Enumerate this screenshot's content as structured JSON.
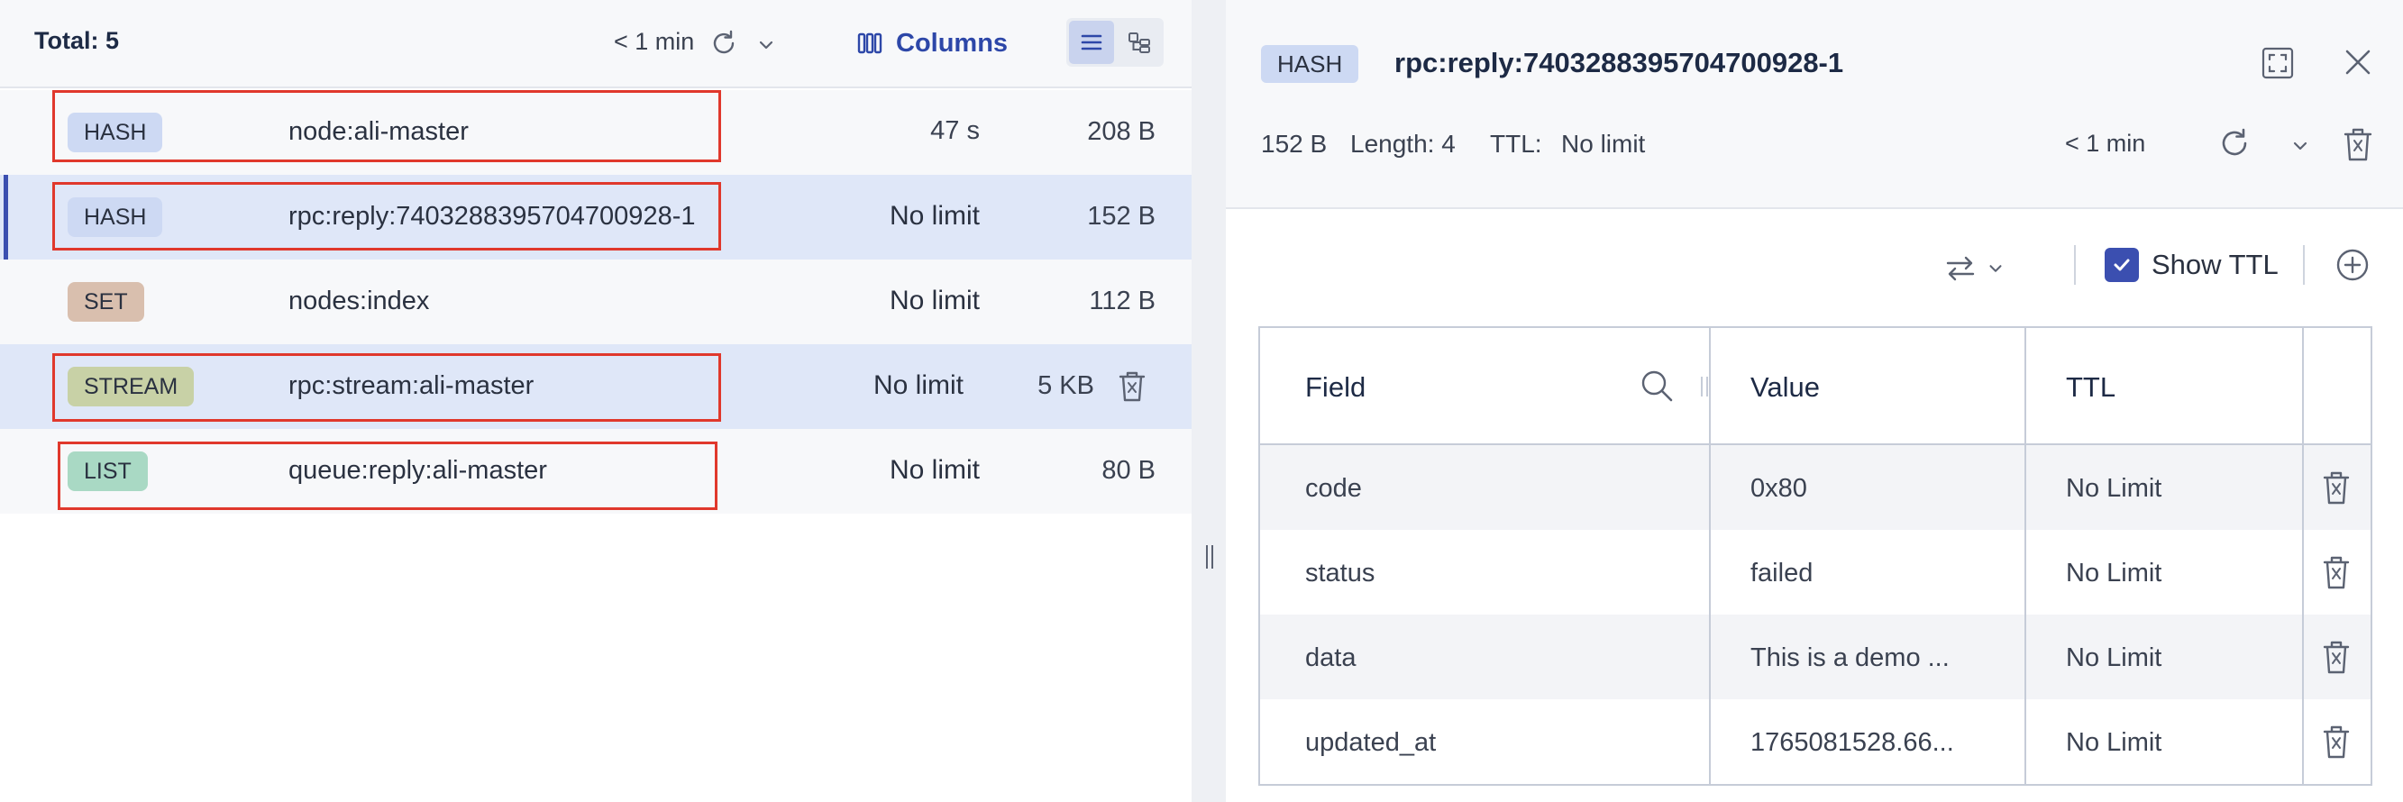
{
  "key_list": {
    "total_label": "Total: 5",
    "refresh_text": "< 1 min",
    "columns_label": "Columns",
    "rows": [
      {
        "type": "HASH",
        "name": "node:ali-master",
        "ttl": "47 s",
        "size": "208 B"
      },
      {
        "type": "HASH",
        "name": "rpc:reply:7403288395704700928-1",
        "ttl": "No limit",
        "size": "152 B"
      },
      {
        "type": "SET",
        "name": "nodes:index",
        "ttl": "No limit",
        "size": "112 B"
      },
      {
        "type": "STREAM",
        "name": "rpc:stream:ali-master",
        "ttl": "No limit",
        "size": "5 KB"
      },
      {
        "type": "LIST",
        "name": "queue:reply:ali-master",
        "ttl": "No limit",
        "size": "80 B"
      }
    ]
  },
  "details": {
    "type": "HASH",
    "key_name": "rpc:reply:7403288395704700928-1",
    "size": "152 B",
    "length": "Length: 4",
    "ttl_label": "TTL:",
    "ttl_value": "No limit",
    "refresh_text": "< 1 min",
    "show_ttl_label": "Show TTL",
    "show_ttl_checked": true,
    "columns": {
      "field": "Field",
      "value": "Value",
      "ttl": "TTL"
    },
    "rows": [
      {
        "field": "code",
        "value": "0x80",
        "ttl": "No Limit"
      },
      {
        "field": "status",
        "value": "failed",
        "ttl": "No Limit"
      },
      {
        "field": "data",
        "value": "This is a demo ...",
        "ttl": "No Limit"
      },
      {
        "field": "updated_at",
        "value": "1765081528.66...",
        "ttl": "No Limit"
      }
    ]
  },
  "colors": {
    "accent": "#3b4fb0",
    "selected_row": "#dfe7f8",
    "highlight_box": "#e0382c",
    "hash_badge": "#cdd9f3",
    "set_badge": "#d9bfae",
    "stream_badge": "#c8d1a6",
    "list_badge": "#a9d9c4"
  },
  "icons": [
    "refresh-icon",
    "chevron-down-icon",
    "columns-icon",
    "list-view-icon",
    "tree-view-icon",
    "trash-icon",
    "expand-icon",
    "close-icon",
    "format-switch-icon",
    "checkbox-icon",
    "add-icon",
    "search-icon"
  ]
}
